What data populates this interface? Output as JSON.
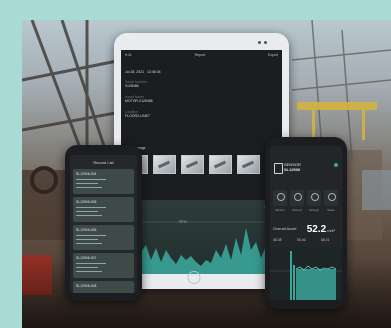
{
  "tablet": {
    "header_left": "9:41",
    "header_title": "Report",
    "header_action": "Export",
    "date": "Jul 28, 2021",
    "time": "12:46:34",
    "fields": [
      {
        "label": "Serial Number",
        "value": "0128486"
      },
      {
        "label": "Asset Name",
        "value": "MOTOR-0128486"
      },
      {
        "label": "Location",
        "value": "FLOOR2-LINE7"
      }
    ],
    "images_label": "Attach Image",
    "peak_value": "6229",
    "axis_label": "RPM"
  },
  "phone_left": {
    "title": "Record List",
    "records": [
      "SL12506-004",
      "SL12506-005",
      "SL12506-006",
      "SL12506-007",
      "SL12506-008"
    ]
  },
  "phone_right": {
    "device_name": "SENSOR",
    "device_id": "SL12506",
    "tools": [
      "Monitor",
      "Record",
      "Settings",
      "Share"
    ],
    "metric_label": "Overall Accel",
    "metric_value": "52.2",
    "metric_unit": "m/s²",
    "stats": [
      "48.38",
      "50.46",
      "68.21"
    ]
  },
  "colors": {
    "background": "#a8dad6",
    "screen": "#1b1d20",
    "accent": "#3aa59a"
  }
}
